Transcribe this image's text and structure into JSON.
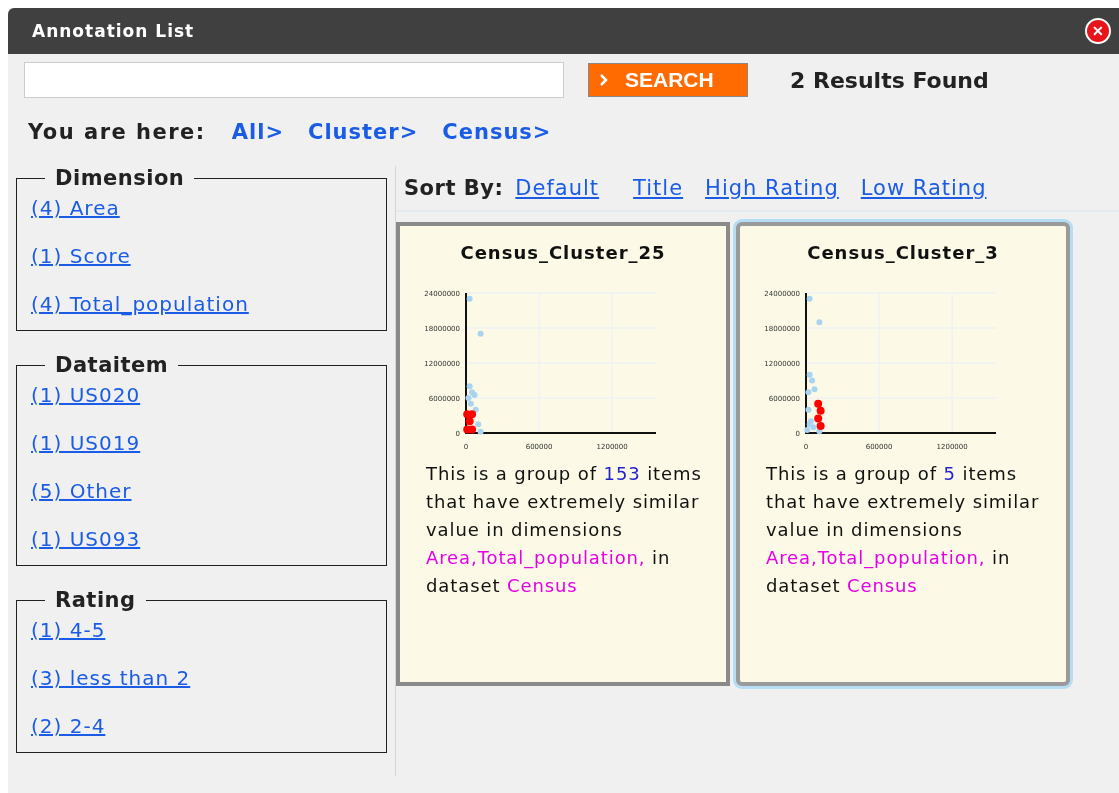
{
  "window": {
    "title": "Annotation List",
    "close_icon": "✕"
  },
  "search": {
    "button": "SEARCH",
    "results": "2 Results Found"
  },
  "breadcrumb": {
    "label": "You are here:",
    "links": [
      "All>",
      "Cluster>",
      "Census>"
    ]
  },
  "facets": [
    {
      "title": "Dimension",
      "items": [
        "(4) Area",
        "(1) Score",
        "(4) Total_population"
      ]
    },
    {
      "title": "Dataitem",
      "items": [
        "(1) US020",
        "(1) US019",
        "(5) Other",
        "(1) US093"
      ]
    },
    {
      "title": "Rating",
      "items": [
        "(1) 4-5",
        "(3) less than 2",
        "(2) 2-4"
      ]
    }
  ],
  "sort": {
    "label": "Sort By:",
    "options": [
      "Default",
      "Title",
      "High Rating",
      "Low Rating"
    ]
  },
  "cards": [
    {
      "title": "Census_Cluster_25",
      "selected": false,
      "chart_data": {
        "type": "scatter",
        "grid": true,
        "xlim": [
          0,
          1560000
        ],
        "ylim": [
          0,
          24000000
        ],
        "xticks": [
          0,
          600000,
          1200000
        ],
        "yticks": [
          0,
          6000000,
          12000000,
          18000000,
          24000000
        ],
        "series": [
          {
            "color": "#a9d3ef",
            "x": [
              30000,
              120000,
              30000,
              50000,
              20000,
              80000,
              100000,
              120000,
              60000,
              40000,
              70000
            ],
            "values": [
              23000000,
              17000000,
              8000000,
              7000000,
              6000000,
              4000000,
              1500000,
              200000,
              null,
              5000000,
              6500000
            ]
          },
          {
            "color": "#ff0000",
            "x": [
              10000,
              50000,
              30000,
              10000,
              50000
            ],
            "values": [
              600000,
              600000,
              2000000,
              3200000,
              3200000
            ]
          }
        ]
      },
      "description": [
        {
          "kind": "plain",
          "text": "This is a group of "
        },
        {
          "kind": "number",
          "text": "153"
        },
        {
          "kind": "plain",
          "text": " items that have extremely similar value in dimensions "
        },
        {
          "kind": "term",
          "text": "Area,Total_population,"
        },
        {
          "kind": "plain",
          "text": " in dataset "
        },
        {
          "kind": "term",
          "text": "Census"
        }
      ]
    },
    {
      "title": "Census_Cluster_3",
      "selected": true,
      "chart_data": {
        "type": "scatter",
        "grid": true,
        "xlim": [
          0,
          1560000
        ],
        "ylim": [
          0,
          24000000
        ],
        "xticks": [
          0,
          600000,
          1200000
        ],
        "yticks": [
          0,
          6000000,
          12000000,
          18000000,
          24000000
        ],
        "series": [
          {
            "color": "#a9d3ef",
            "x": [
              30000,
              110000,
              30000,
              50000,
              20000,
              70000,
              20000,
              40000,
              60000,
              110000,
              10000,
              30000
            ],
            "values": [
              23000000,
              19000000,
              10000000,
              9000000,
              7000000,
              7500000,
              4000000,
              2000000,
              1000000,
              300000,
              500000,
              1500000
            ]
          },
          {
            "color": "#ff0000",
            "x": [
              100000,
              120000,
              100000,
              120000
            ],
            "values": [
              5000000,
              3800000,
              2500000,
              1200000
            ]
          }
        ]
      },
      "description": [
        {
          "kind": "plain",
          "text": "This is a group of "
        },
        {
          "kind": "number",
          "text": "5"
        },
        {
          "kind": "plain",
          "text": " items that have extremely similar value in dimensions "
        },
        {
          "kind": "term",
          "text": "Area,Total_population,"
        },
        {
          "kind": "plain",
          "text": " in dataset "
        },
        {
          "kind": "term",
          "text": "Census"
        }
      ]
    }
  ]
}
